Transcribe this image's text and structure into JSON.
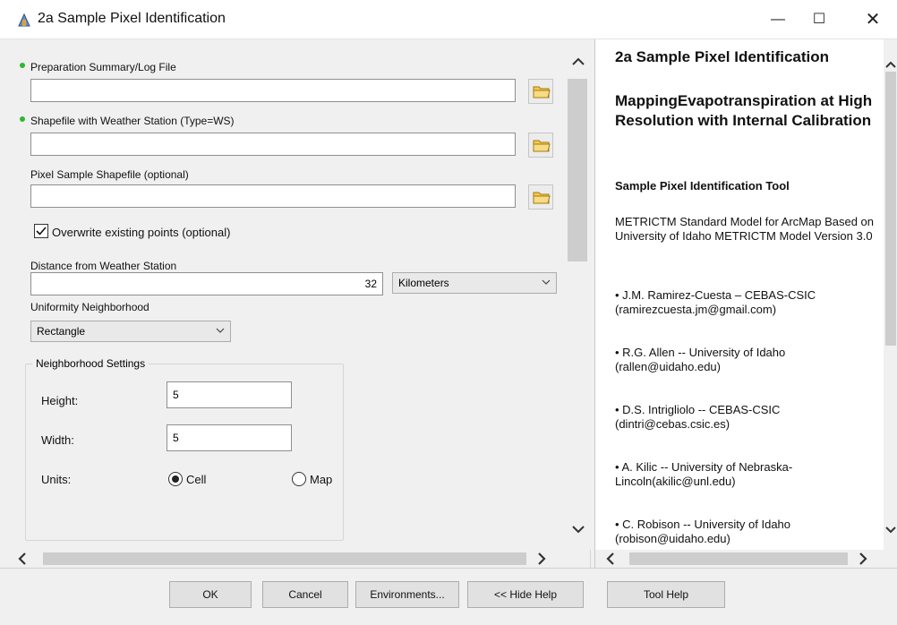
{
  "window": {
    "title": "2a Sample Pixel Identification",
    "minimize_glyph": "—",
    "maximize_glyph": "☐",
    "close_glyph": "✕"
  },
  "form": {
    "prep_label": "Preparation Summary/Log File",
    "prep_value": "",
    "shapefile_label": "Shapefile with Weather Station (Type=WS)",
    "shapefile_value": "",
    "pixel_label": "Pixel Sample Shapefile (optional)",
    "pixel_value": "",
    "overwrite_label": "Overwrite existing points (optional)",
    "overwrite_checked": true,
    "distance_label": "Distance from Weather Station",
    "distance_value": "32",
    "distance_unit": "Kilometers",
    "uniformity_label": "Uniformity Neighborhood",
    "uniformity_value": "Rectangle",
    "neighborhood_title": "Neighborhood Settings",
    "height_label": "Height:",
    "height_value": "5",
    "width_label": "Width:",
    "width_value": "5",
    "units_label": "Units:",
    "unit_cell": "Cell",
    "unit_map": "Map",
    "unit_selected": "Cell"
  },
  "help": {
    "h1": "2a Sample Pixel Identification",
    "h2": "MappingEvapotranspiration at High Resolution with Internal Calibration",
    "h3": "Sample Pixel Identification Tool",
    "p1": "METRICTM Standard Model for ArcMap Based on University of Idaho METRICTM Model Version 3.0",
    "p2": "• J.M. Ramirez-Cuesta – CEBAS-CSIC (ramirezcuesta.jm@gmail.com)",
    "p3": "• R.G. Allen -- University of Idaho (rallen@uidaho.edu)",
    "p4": "• D.S. Intrigliolo -- CEBAS-CSIC (dintri@cebas.csic.es)",
    "p5": "• A. Kilic -- University of Nebraska-Lincoln(akilic@unl.edu)",
    "p6": "• C. Robison -- University of Idaho (robison@uidaho.edu)"
  },
  "buttons": {
    "ok": "OK",
    "cancel": "Cancel",
    "environments": "Environments...",
    "hide_help": "<< Hide Help",
    "tool_help": "Tool Help"
  },
  "colors": {
    "required_dot": "#2fb82f",
    "folder_yellow": "#f2c94c"
  }
}
